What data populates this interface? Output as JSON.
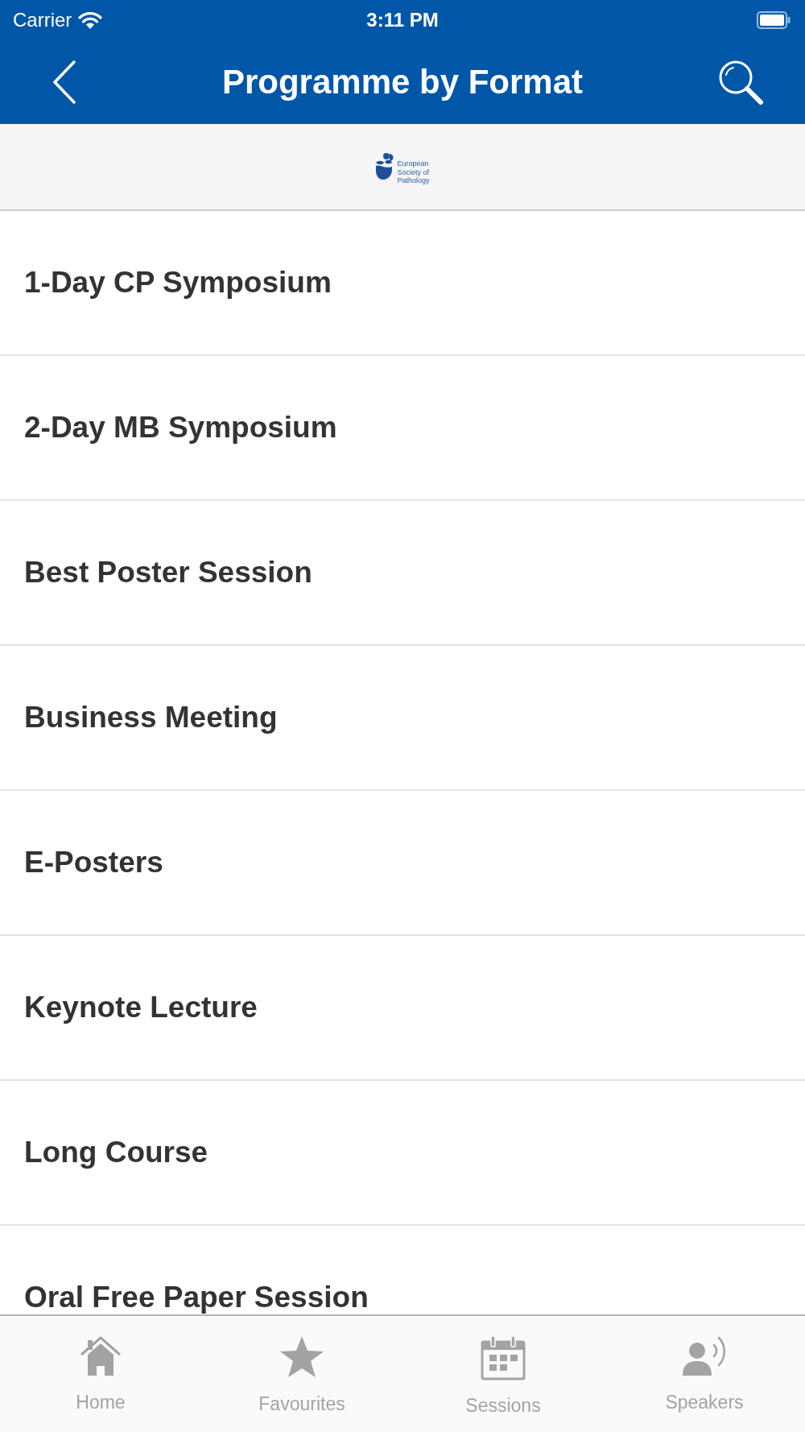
{
  "status_bar": {
    "carrier": "Carrier",
    "time": "3:11 PM"
  },
  "nav_bar": {
    "title": "Programme by Format"
  },
  "logo": {
    "lines": [
      "European",
      "Society of",
      "Pathology"
    ]
  },
  "formats": [
    {
      "label": "1-Day CP Symposium"
    },
    {
      "label": "2-Day MB Symposium"
    },
    {
      "label": "Best Poster Session"
    },
    {
      "label": "Business Meeting"
    },
    {
      "label": "E-Posters"
    },
    {
      "label": "Keynote Lecture"
    },
    {
      "label": "Long Course"
    },
    {
      "label": "Oral Free Paper Session"
    }
  ],
  "tab_bar": [
    {
      "kind": "home",
      "label": "Home",
      "selected": false
    },
    {
      "kind": "favourites",
      "label": "Favourites",
      "selected": false
    },
    {
      "kind": "sessions",
      "label": "Sessions",
      "selected": false
    },
    {
      "kind": "speakers",
      "label": "Speakers",
      "selected": false
    }
  ]
}
